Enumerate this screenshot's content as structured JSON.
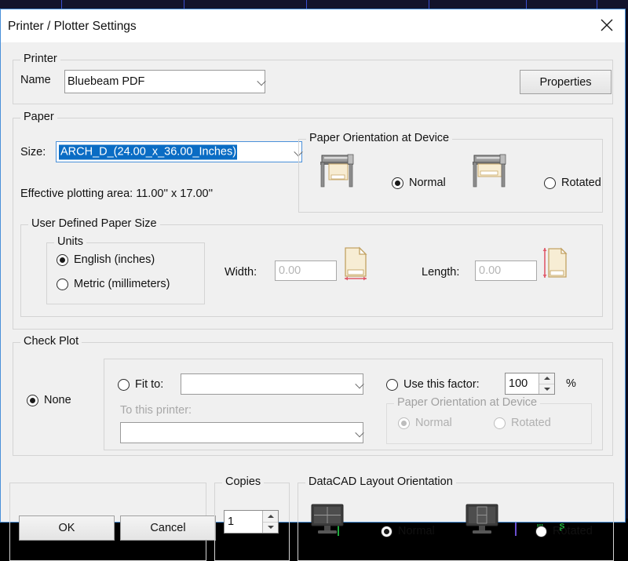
{
  "window": {
    "title": "Printer / Plotter Settings",
    "close_icon": "close-icon"
  },
  "printer": {
    "group_label": "Printer",
    "name_label": "Name",
    "name_value": "Bluebeam PDF",
    "properties_label": "Properties"
  },
  "paper": {
    "group_label": "Paper",
    "size_label": "Size:",
    "size_value": "ARCH_D_(24.00_x_36.00_Inches)",
    "effective_area": "Effective plotting area: 11.00'' x 17.00''",
    "orientation": {
      "group_label": "Paper Orientation at Device",
      "normal_label": "Normal",
      "rotated_label": "Rotated",
      "selected": "Normal"
    }
  },
  "user_defined": {
    "group_label": "User Defined Paper Size",
    "units": {
      "group_label": "Units",
      "english_label": "English (inches)",
      "metric_label": "Metric (millimeters)",
      "selected": "English (inches)"
    },
    "width_label": "Width:",
    "width_value": "0.00",
    "length_label": "Length:",
    "length_value": "0.00"
  },
  "check_plot": {
    "group_label": "Check Plot",
    "none_label": "None",
    "none_selected": true,
    "fit_to_label": "Fit to:",
    "fit_to_value": "",
    "to_this_printer_label": "To this printer:",
    "to_this_printer_value": "",
    "use_factor_label": "Use this factor:",
    "factor_value": "100",
    "percent_label": "%",
    "orientation": {
      "group_label": "Paper Orientation at Device",
      "normal_label": "Normal",
      "rotated_label": "Rotated",
      "selected": "Normal",
      "disabled": true
    }
  },
  "footer": {
    "ok_label": "OK",
    "cancel_label": "Cancel",
    "copies": {
      "group_label": "Copies",
      "value": "1"
    },
    "layout_orientation": {
      "group_label": "DataCAD Layout Orientation",
      "normal_label": "Normal",
      "rotated_label": "Rotated",
      "selected": "Normal"
    }
  },
  "colors": {
    "dialog_bg": "#f0f0f0",
    "accent_border": "#4a90d9",
    "selection_blue": "#0a6cc4",
    "backdrop_dark": "#0c0c1e",
    "backdrop_divider": "#3b4fd0",
    "paper_yellow": "#f5e7c0",
    "arrow_red": "#e05a6a",
    "monitor_dark": "#3a3a3a",
    "status_green": "#1faa3c"
  }
}
